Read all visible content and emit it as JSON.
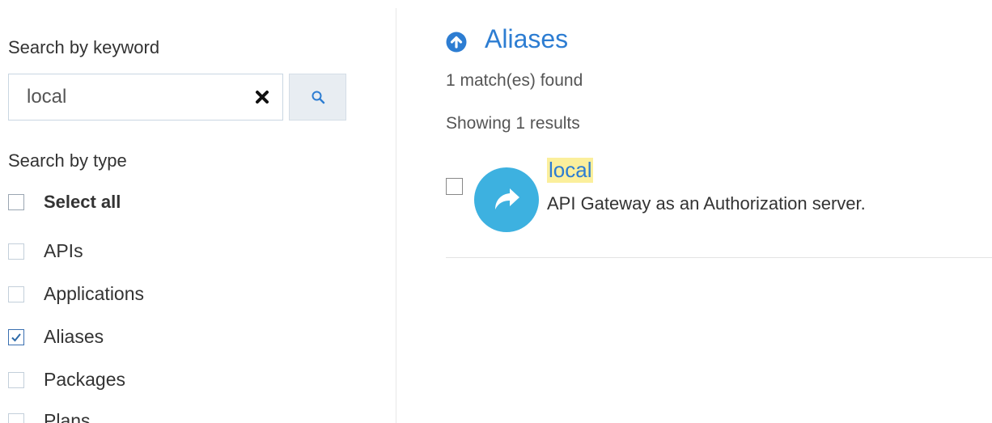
{
  "filters": {
    "keyword_title": "Search by keyword",
    "search_value": "local",
    "type_title": "Search by type",
    "select_all_label": "Select all",
    "types": [
      {
        "label": "APIs",
        "checked": false
      },
      {
        "label": "Applications",
        "checked": false
      },
      {
        "label": "Aliases",
        "checked": true
      },
      {
        "label": "Packages",
        "checked": false
      },
      {
        "label": "Plans",
        "checked": false
      }
    ]
  },
  "results": {
    "title": "Aliases",
    "match_text": "1 match(es) found",
    "showing_text": "Showing 1 results",
    "items": [
      {
        "name": "local",
        "description": "API Gateway as an Authorization server."
      }
    ]
  },
  "icons": {
    "clear": "close-icon",
    "search": "search-icon",
    "section": "arrow-up-circle-icon",
    "avatar": "share-arrow-icon",
    "checked": "checkmark-icon"
  },
  "colors": {
    "accent": "#2d7dd2",
    "avatar": "#3db1e0",
    "highlight": "#fbef9c"
  }
}
